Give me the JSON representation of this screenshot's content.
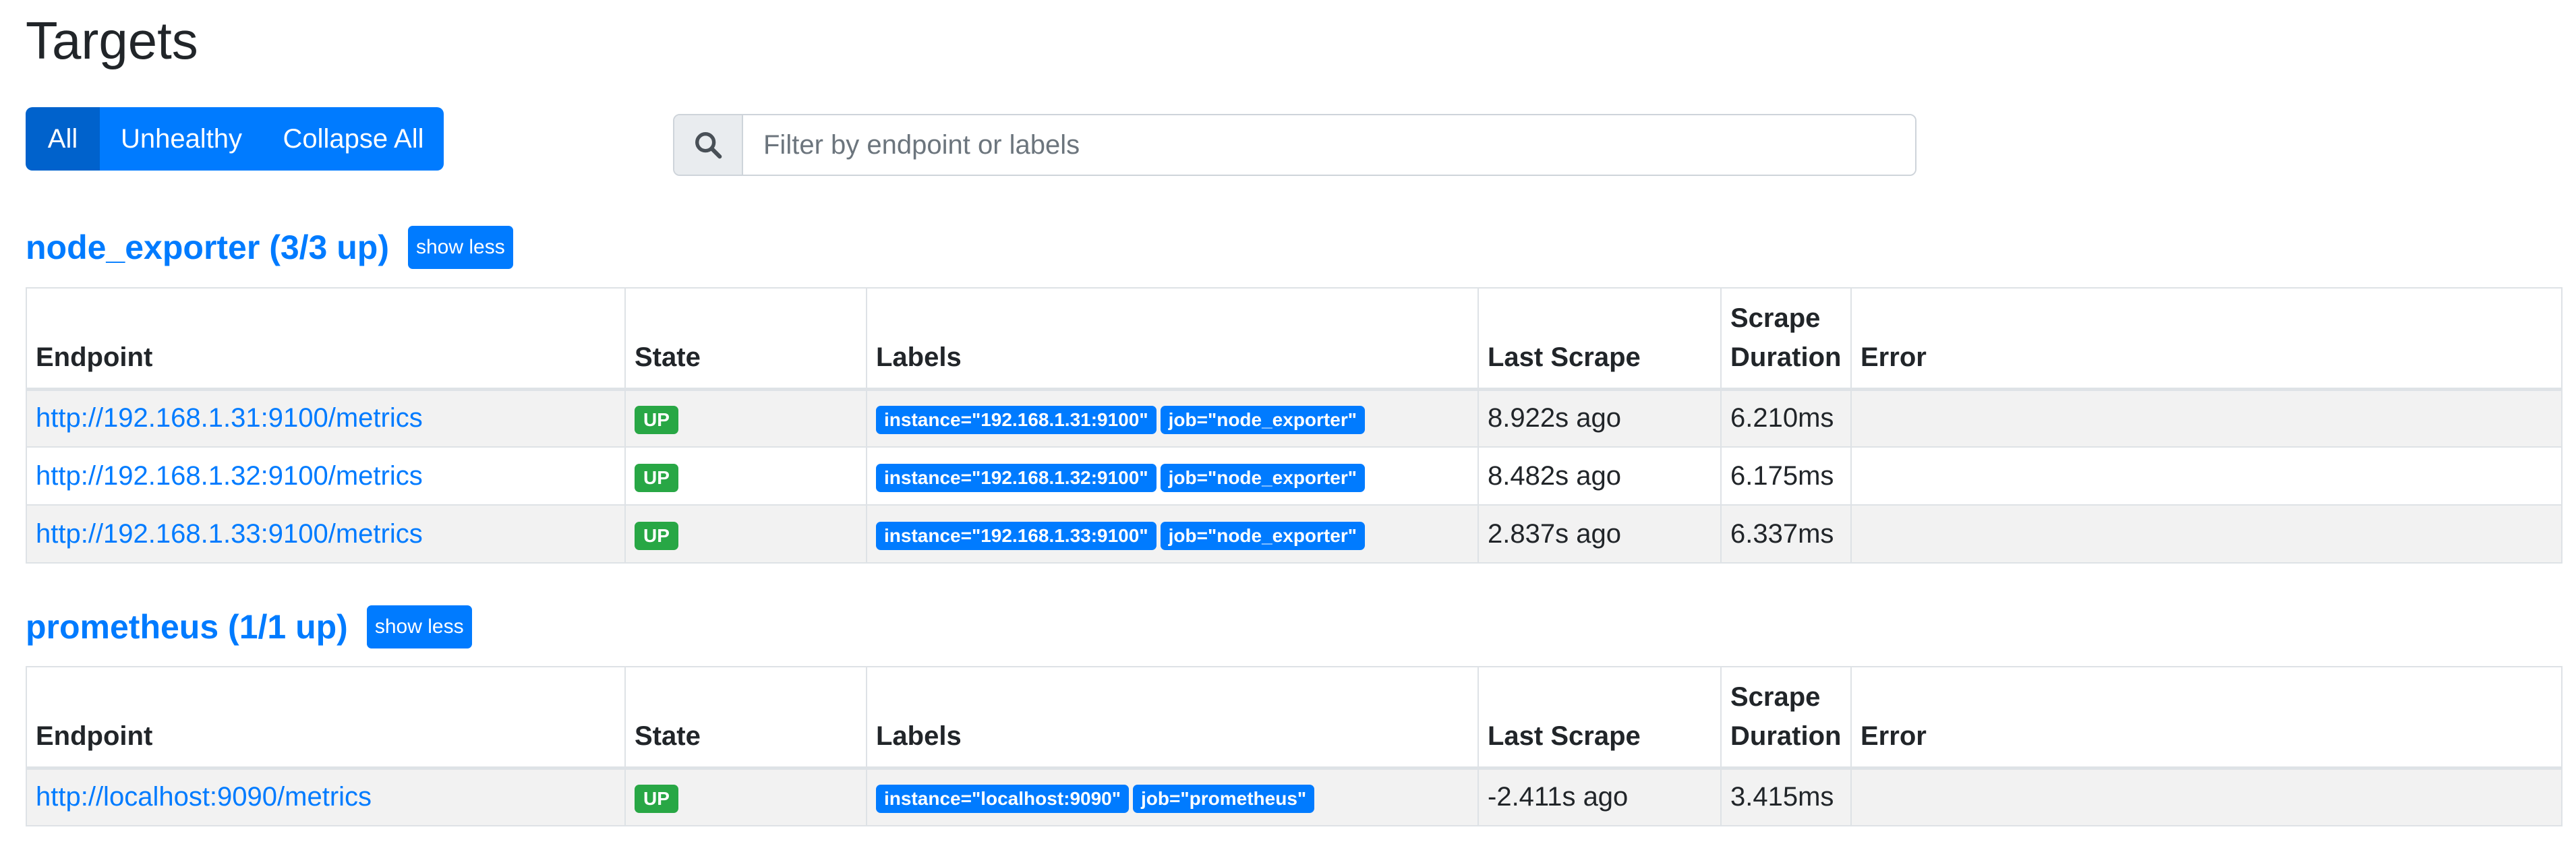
{
  "page": {
    "title": "Targets"
  },
  "filters": {
    "all_label": "All",
    "unhealthy_label": "Unhealthy",
    "collapse_label": "Collapse All"
  },
  "search": {
    "icon": "search-icon",
    "placeholder": "Filter by endpoint or labels",
    "value": ""
  },
  "columns": {
    "endpoint": "Endpoint",
    "state": "State",
    "labels": "Labels",
    "last_scrape": "Last Scrape",
    "scrape_duration_line1": "Scrape",
    "scrape_duration_line2": "Duration",
    "error": "Error"
  },
  "jobs": [
    {
      "title": "node_exporter (3/3 up)",
      "toggle_label": "show less",
      "rows": [
        {
          "endpoint": "http://192.168.1.31:9100/metrics",
          "state": "UP",
          "labels": [
            "instance=\"192.168.1.31:9100\"",
            "job=\"node_exporter\""
          ],
          "last_scrape": "8.922s ago",
          "scrape_duration": "6.210ms",
          "error": ""
        },
        {
          "endpoint": "http://192.168.1.32:9100/metrics",
          "state": "UP",
          "labels": [
            "instance=\"192.168.1.32:9100\"",
            "job=\"node_exporter\""
          ],
          "last_scrape": "8.482s ago",
          "scrape_duration": "6.175ms",
          "error": ""
        },
        {
          "endpoint": "http://192.168.1.33:9100/metrics",
          "state": "UP",
          "labels": [
            "instance=\"192.168.1.33:9100\"",
            "job=\"node_exporter\""
          ],
          "last_scrape": "2.837s ago",
          "scrape_duration": "6.337ms",
          "error": ""
        }
      ]
    },
    {
      "title": "prometheus (1/1 up)",
      "toggle_label": "show less",
      "rows": [
        {
          "endpoint": "http://localhost:9090/metrics",
          "state": "UP",
          "labels": [
            "instance=\"localhost:9090\"",
            "job=\"prometheus\""
          ],
          "last_scrape": "-2.411s ago",
          "scrape_duration": "3.415ms",
          "error": ""
        }
      ]
    }
  ],
  "colors": {
    "primary": "#007bff",
    "primary_active": "#0062cc",
    "success": "#28a745"
  }
}
